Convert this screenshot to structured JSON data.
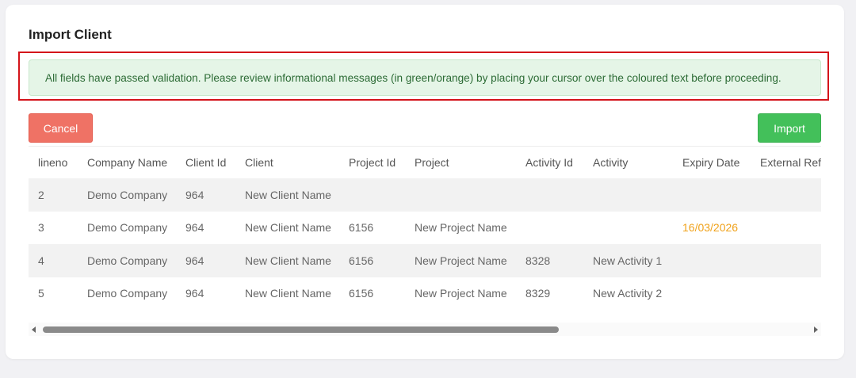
{
  "dialog": {
    "title": "Import Client",
    "alert_message": "All fields have passed validation. Please review informational messages (in green/orange) by placing your cursor over the coloured text before proceeding.",
    "cancel_label": "Cancel",
    "import_label": "Import"
  },
  "colors": {
    "alert_bg": "#e5f5e7",
    "alert_text": "#2c6b35",
    "highlight_border": "#d4141a",
    "cancel_bg": "#ef7265",
    "import_bg": "#43c05a",
    "warning_text": "#f0a21b"
  },
  "table": {
    "columns": [
      "lineno",
      "Company Name",
      "Client Id",
      "Client",
      "Project Id",
      "Project",
      "Activity Id",
      "Activity",
      "Expiry Date",
      "External Ref"
    ],
    "rows": [
      [
        "2",
        "Demo Company",
        "964",
        "New Client Name",
        "",
        "",
        "",
        "",
        "",
        ""
      ],
      [
        "3",
        "Demo Company",
        "964",
        "New Client Name",
        "6156",
        "New Project Name",
        "",
        "",
        "16/03/2026",
        ""
      ],
      [
        "4",
        "Demo Company",
        "964",
        "New Client Name",
        "6156",
        "New Project Name",
        "8328",
        "New Activity 1",
        "",
        ""
      ],
      [
        "5",
        "Demo Company",
        "964",
        "New Client Name",
        "6156",
        "New Project Name",
        "8329",
        "New Activity 2",
        "",
        ""
      ]
    ]
  }
}
